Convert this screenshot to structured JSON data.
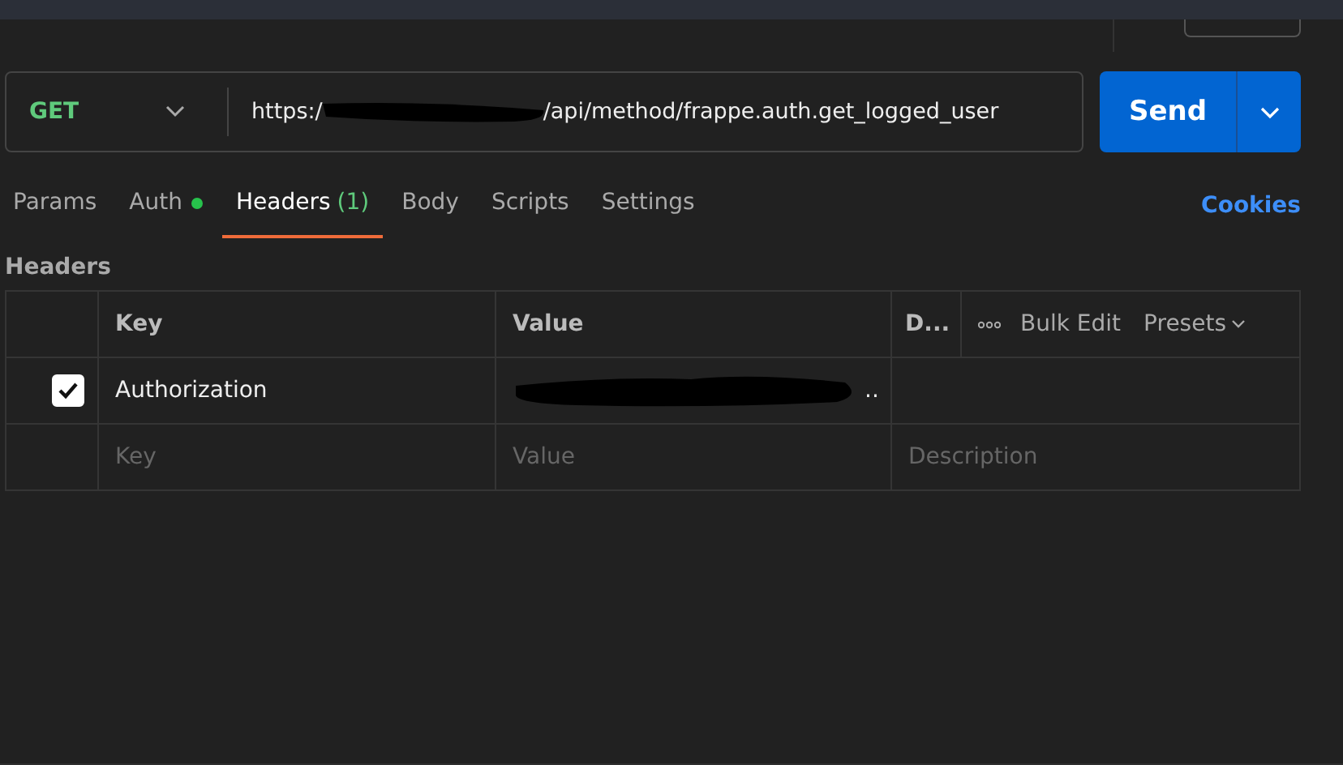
{
  "request": {
    "method": "GET",
    "url_start": "https:/",
    "url_redacted": true,
    "url_end": "/api/method/frappe.auth.get_logged_user",
    "send": "Send"
  },
  "tabs": [
    {
      "label": "Params",
      "selected": false,
      "dot": false
    },
    {
      "label": "Auth",
      "selected": false,
      "dot": true
    },
    {
      "label": "Headers",
      "count": "(1)",
      "selected": true,
      "dot": false
    },
    {
      "label": "Body",
      "selected": false,
      "dot": false
    },
    {
      "label": "Scripts",
      "selected": false,
      "dot": false
    },
    {
      "label": "Settings",
      "selected": false,
      "dot": false
    }
  ],
  "cookies": "Cookies",
  "section_title": "Headers",
  "table": {
    "columns": [
      "Key",
      "Value",
      "D..."
    ],
    "bulk_edit": "Bulk Edit",
    "presets": "Presets",
    "rows": [
      {
        "checked": true,
        "key": "Authorization",
        "value_redacted": true,
        "value": ".."
      }
    ],
    "placeholders": {
      "key": "Key",
      "value": "Value",
      "description": "Description"
    }
  }
}
